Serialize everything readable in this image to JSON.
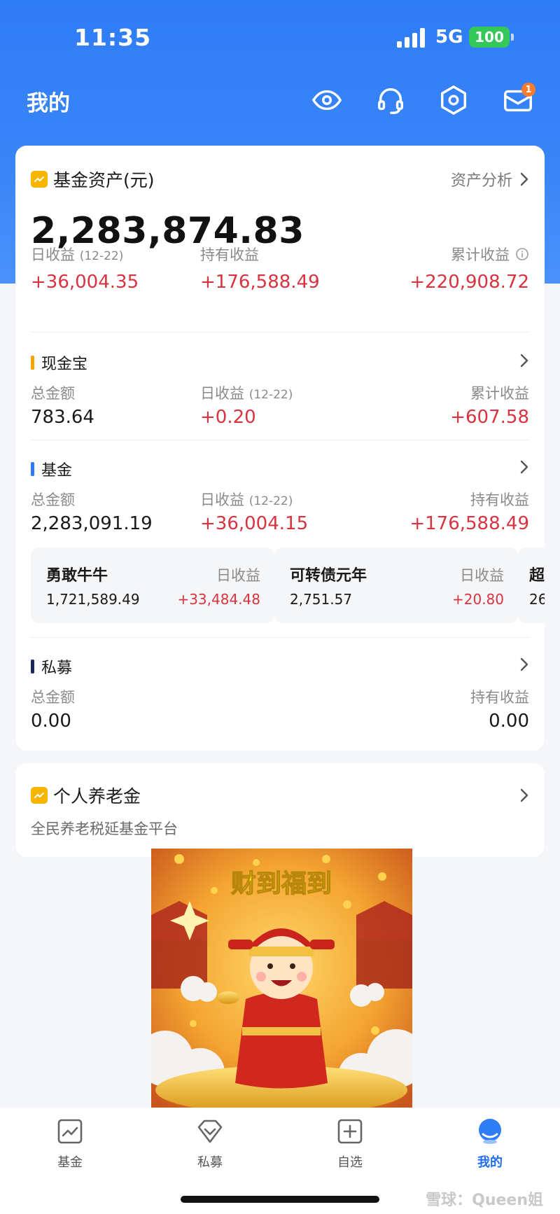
{
  "status_bar": {
    "time": "11:35",
    "network": "5G",
    "battery": "100"
  },
  "header": {
    "title": "我的",
    "icons": [
      "eye-icon",
      "headset-icon",
      "settings-hexagon-icon",
      "mail-icon"
    ],
    "mail_badge": "1"
  },
  "assets": {
    "title": "基金资产(元)",
    "analysis_link": "资产分析",
    "total": "2,283,874.83",
    "daily_label": "日收益",
    "daily_date": "(12-22)",
    "daily_value": "+36,004.35",
    "holding_label": "持有收益",
    "holding_value": "+176,588.49",
    "cumulative_label": "累计收益",
    "cumulative_value": "+220,908.72"
  },
  "cash": {
    "title": "现金宝",
    "total_label": "总金额",
    "total_value": "783.64",
    "daily_label": "日收益",
    "daily_date": "(12-22)",
    "daily_value": "+0.20",
    "cumulative_label": "累计收益",
    "cumulative_value": "+607.58"
  },
  "fund": {
    "title": "基金",
    "total_label": "总金额",
    "total_value": "2,283,091.19",
    "daily_label": "日收益",
    "daily_date": "(12-22)",
    "daily_value": "+36,004.15",
    "holding_label": "持有收益",
    "holding_value": "+176,588.49",
    "holdings": [
      {
        "name": "勇敢牛牛",
        "label": "日收益",
        "amount": "1,721,589.49",
        "earning": "+33,484.48"
      },
      {
        "name": "可转债元年",
        "label": "日收益",
        "amount": "2,751.57",
        "earning": "+20.80"
      },
      {
        "name": "超",
        "amount": "26"
      }
    ]
  },
  "private": {
    "title": "私募",
    "total_label": "总金额",
    "total_value": "0.00",
    "holding_label": "持有收益",
    "holding_value": "0.00"
  },
  "pension": {
    "title": "个人养老金",
    "subtitle": "全民养老税延基金平台"
  },
  "promo": {
    "text": "财到福到"
  },
  "tabbar": {
    "tabs": [
      {
        "label": "基金",
        "icon": "chart-icon"
      },
      {
        "label": "私募",
        "icon": "diamond-icon"
      },
      {
        "label": "自选",
        "icon": "plus-square-icon"
      },
      {
        "label": "我的",
        "icon": "profile-icon"
      }
    ]
  },
  "watermark": "雪球：Queen姐",
  "colors": {
    "primary_blue": "#2e7cf6",
    "positive_red": "#d9333f",
    "accent_yellow": "#f7b500"
  }
}
